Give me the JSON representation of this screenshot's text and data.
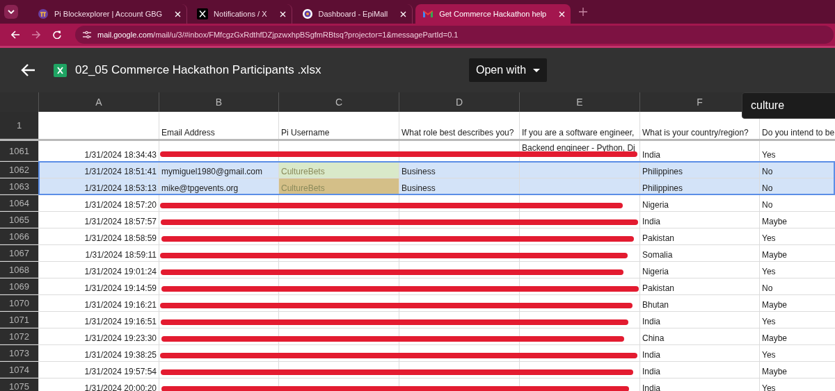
{
  "browser": {
    "tabs": [
      {
        "title": "Pi Blockexplorer | Account GBG",
        "selected": false
      },
      {
        "title": "Notifications / X",
        "selected": false
      },
      {
        "title": "Dashboard - EpiMall",
        "selected": false
      },
      {
        "title": "Get Commerce Hackathon help",
        "selected": true
      }
    ],
    "url": {
      "host": "mail.google.com",
      "path": "/mail/u/3/#inbox/FMfcgzGxRdthfDZjpzwxhpBSgfmRBtsq?projector=1&messagePartId=0.1"
    }
  },
  "viewer": {
    "file_name": "02_05 Commerce Hackathon Participants .xlsx",
    "open_with": "Open with"
  },
  "sheet": {
    "columns": [
      "A",
      "B",
      "C",
      "D",
      "E",
      "F"
    ],
    "header_row": {
      "number": "1",
      "cells": {
        "B": "Email Address",
        "C": "Pi Username",
        "D": "What role best describes you?",
        "E": "If you are a software engineer,",
        "F": "What is your country/region?",
        "G": "Do you intend to be"
      }
    },
    "rows": [
      {
        "number": "1061",
        "selected": false,
        "redacted": true,
        "cells": {
          "A": "1/31/2024 18:34:43",
          "E": "Backend engineer - Python, Dj",
          "F": "India",
          "G": "Yes"
        }
      },
      {
        "number": "1062",
        "selected": true,
        "redacted": false,
        "cells": {
          "A": "1/31/2024 18:51:41",
          "B": "mymiguel1980@gmail.com",
          "C": {
            "text": "CultureBets",
            "color": "#d9e9c9"
          },
          "D": "Business",
          "F": "Philippines",
          "G": "No"
        }
      },
      {
        "number": "1063",
        "selected": true,
        "redacted": false,
        "cells": {
          "A": "1/31/2024 18:53:13",
          "B": "mike@tpgevents.org",
          "C": {
            "text": "CultureBets",
            "color": "#d4bf88"
          },
          "D": "Business",
          "F": "Philippines",
          "G": "No"
        }
      },
      {
        "number": "1064",
        "selected": false,
        "redacted": true,
        "cells": {
          "A": "1/31/2024 18:57:20",
          "F": "Nigeria",
          "G": "No"
        }
      },
      {
        "number": "1065",
        "selected": false,
        "redacted": true,
        "cells": {
          "A": "1/31/2024 18:57:57",
          "F": "India",
          "G": "Maybe"
        }
      },
      {
        "number": "1066",
        "selected": false,
        "redacted": true,
        "cells": {
          "A": "1/31/2024 18:58:59",
          "F": "Pakistan",
          "G": "Yes"
        }
      },
      {
        "number": "1067",
        "selected": false,
        "redacted": true,
        "cells": {
          "A": "1/31/2024 18:59:11",
          "F": "Somalia",
          "G": "Maybe"
        }
      },
      {
        "number": "1068",
        "selected": false,
        "redacted": true,
        "cells": {
          "A": "1/31/2024 19:01:24",
          "F": "Nigeria",
          "G": "Yes"
        }
      },
      {
        "number": "1069",
        "selected": false,
        "redacted": true,
        "cells": {
          "A": "1/31/2024 19:14:59",
          "F": "Pakistan",
          "G": "No"
        }
      },
      {
        "number": "1070",
        "selected": false,
        "redacted": true,
        "cells": {
          "A": "1/31/2024 19:16:21",
          "F": "Bhutan",
          "G": "Maybe"
        }
      },
      {
        "number": "1071",
        "selected": false,
        "redacted": true,
        "cells": {
          "A": "1/31/2024 19:16:51",
          "F": "India",
          "G": "Yes"
        }
      },
      {
        "number": "1072",
        "selected": false,
        "redacted": true,
        "cells": {
          "A": "1/31/2024 19:23:30",
          "F": "China",
          "G": "Maybe"
        }
      },
      {
        "number": "1073",
        "selected": false,
        "redacted": true,
        "cells": {
          "A": "1/31/2024 19:38:25",
          "F": "India",
          "G": "Yes"
        }
      },
      {
        "number": "1074",
        "selected": false,
        "redacted": true,
        "cells": {
          "A": "1/31/2024 19:57:54",
          "F": "India",
          "G": "Maybe"
        }
      },
      {
        "number": "1075",
        "selected": false,
        "redacted": true,
        "cells": {
          "A": "1/31/2024 20:00:20",
          "F": "India",
          "G": "Yes"
        }
      }
    ],
    "find": {
      "query": "culture"
    }
  }
}
